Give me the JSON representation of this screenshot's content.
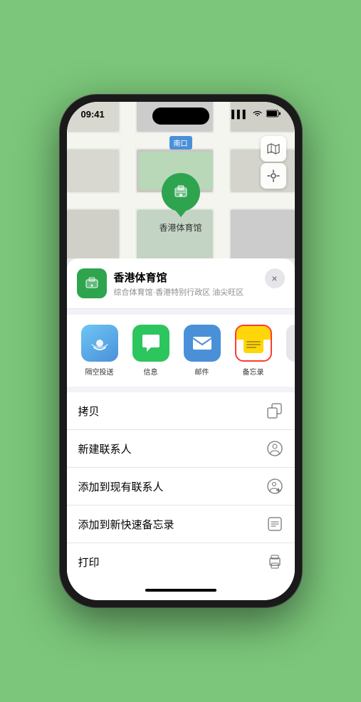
{
  "phone": {
    "status_bar": {
      "time": "09:41",
      "signal_icon": "▌▌▌",
      "wifi_icon": "WiFi",
      "battery_icon": "🔋"
    },
    "map": {
      "location_label": "南口",
      "pin_label": "香港体育馆",
      "controls": {
        "map_type_icon": "map",
        "location_icon": "location"
      }
    },
    "bottom_sheet": {
      "venue_icon": "🏟",
      "venue_name": "香港体育馆",
      "venue_subtitle": "综合体育馆·香港特别行政区 油尖旺区",
      "close_label": "×",
      "share_items": [
        {
          "id": "airdrop",
          "label": "隔空投送",
          "icon": "airdrop"
        },
        {
          "id": "messages",
          "label": "信息",
          "icon": "messages"
        },
        {
          "id": "mail",
          "label": "邮件",
          "icon": "mail"
        },
        {
          "id": "notes",
          "label": "备忘录",
          "icon": "notes",
          "selected": true
        },
        {
          "id": "more",
          "label": "提",
          "icon": "more"
        }
      ],
      "actions": [
        {
          "id": "copy",
          "label": "拷贝",
          "icon": "copy"
        },
        {
          "id": "new-contact",
          "label": "新建联系人",
          "icon": "new-contact"
        },
        {
          "id": "add-existing",
          "label": "添加到现有联系人",
          "icon": "add-existing"
        },
        {
          "id": "add-note",
          "label": "添加到新快速备忘录",
          "icon": "add-note"
        },
        {
          "id": "print",
          "label": "打印",
          "icon": "print"
        }
      ]
    }
  }
}
